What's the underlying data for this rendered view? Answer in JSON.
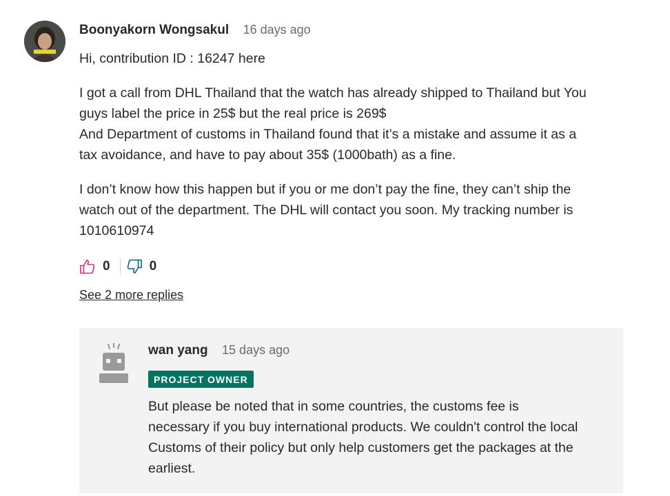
{
  "comment": {
    "author": "Boonyakorn Wongsakul",
    "time": "16 days ago",
    "paragraphs": [
      [
        "Hi, contribution ID : 16247 here"
      ],
      [
        "I got a call from DHL Thailand that the watch has already shipped to Thailand but You",
        "guys label the price in 25$ but the real price is 269$",
        "And Department of customs in Thailand found that it’s a mistake and assume it as a",
        "tax avoidance, and have to pay about 35$ (1000bath) as a fine."
      ],
      [
        "I don’t know how this happen but if you or me don’t pay the fine, they can’t ship the",
        "watch out of the department. The DHL will contact you soon. My tracking number is",
        "1010610974"
      ]
    ],
    "upvotes": "0",
    "downvotes": "0",
    "see_more": "See 2 more replies"
  },
  "reply": {
    "author": "wan yang",
    "time": "15 days ago",
    "badge": "PROJECT OWNER",
    "lines": [
      "But please be noted that in some countries, the customs fee is",
      "necessary if you buy international products. We couldn't control the local",
      "Customs of their policy but only help customers get the packages at the",
      "earliest."
    ]
  },
  "colors": {
    "accent_pink": "#e0287a",
    "owner_badge": "#037362",
    "reply_bg": "#f3f3f3"
  },
  "icons": {
    "upvote": "thumbs-up-icon",
    "downvote": "thumbs-down-icon"
  }
}
